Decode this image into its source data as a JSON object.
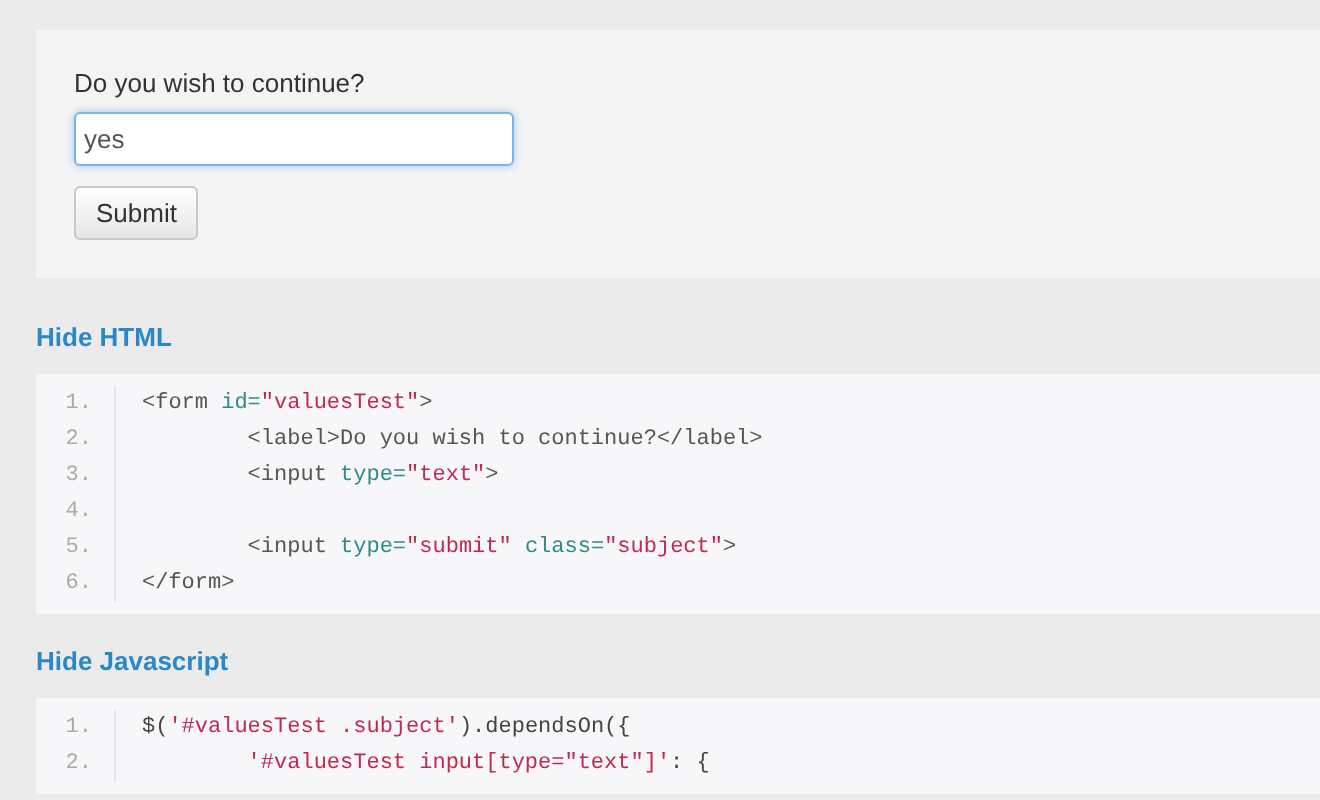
{
  "demo": {
    "label": "Do you wish to continue?",
    "input_value": "yes",
    "button": "Submit"
  },
  "sections": [
    {
      "toggle": "Hide HTML",
      "lines": [
        {
          "number": "1.",
          "tokens": [
            {
              "kind": "tag",
              "text": "<form "
            },
            {
              "kind": "attr",
              "text": "id="
            },
            {
              "kind": "string",
              "text": "\"valuesTest\""
            },
            {
              "kind": "tag",
              "text": ">"
            }
          ]
        },
        {
          "number": "2.",
          "tokens": [
            {
              "kind": "tag",
              "text": "        <label>Do you wish to continue?</label>"
            }
          ]
        },
        {
          "number": "3.",
          "tokens": [
            {
              "kind": "tag",
              "text": "        <input "
            },
            {
              "kind": "attr",
              "text": "type="
            },
            {
              "kind": "string",
              "text": "\"text\""
            },
            {
              "kind": "tag",
              "text": ">"
            }
          ]
        },
        {
          "number": "4."
        },
        {
          "number": "5.",
          "tokens": [
            {
              "kind": "tag",
              "text": "        <input "
            },
            {
              "kind": "attr",
              "text": "type="
            },
            {
              "kind": "string",
              "text": "\"submit\""
            },
            {
              "kind": "attr",
              "text": " class="
            },
            {
              "kind": "string",
              "text": "\"subject\""
            },
            {
              "kind": "tag",
              "text": ">"
            }
          ]
        },
        {
          "number": "6.",
          "tokens": [
            {
              "kind": "tag",
              "text": "</form>"
            }
          ]
        }
      ]
    },
    {
      "toggle": "Hide Javascript",
      "lines": [
        {
          "number": "1.",
          "tokens": [
            {
              "kind": "plain",
              "text": "$("
            },
            {
              "kind": "string",
              "text": "'#valuesTest .subject'"
            },
            {
              "kind": "plain",
              "text": ").dependsOn({"
            }
          ]
        },
        {
          "number": "2.",
          "tokens": [
            {
              "kind": "string",
              "text": "        '#valuesTest input[type=\"text\"]'"
            },
            {
              "kind": "plain",
              "text": ": {"
            }
          ]
        }
      ]
    }
  ]
}
